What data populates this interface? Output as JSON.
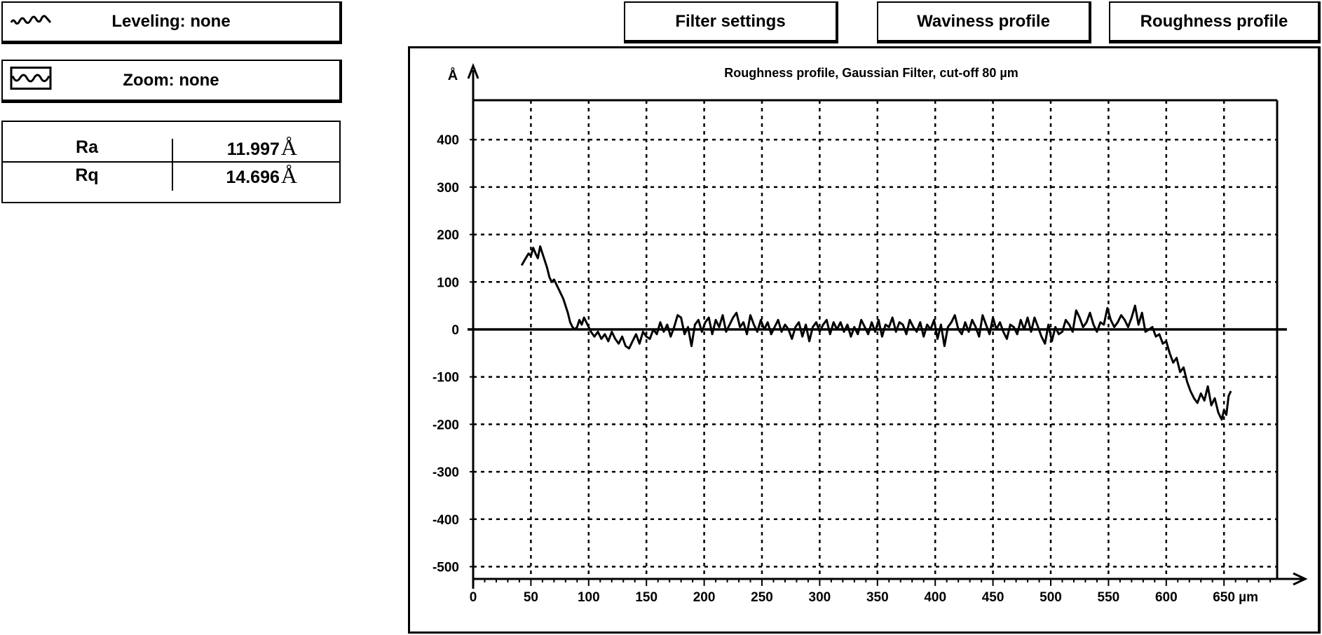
{
  "left_panel": {
    "leveling_button": {
      "label": "Leveling: none",
      "icon": "wave-icon"
    },
    "zoom_button": {
      "label": "Zoom: none",
      "icon": "boxed-wave-icon"
    },
    "metrics": [
      {
        "name": "Ra",
        "value": "11.997",
        "unit": "Å"
      },
      {
        "name": "Rq",
        "value": "14.696",
        "unit": "Å"
      }
    ]
  },
  "toolbar": {
    "filter_settings": "Filter settings",
    "waviness_profile": "Waviness profile",
    "roughness_profile": "Roughness profile"
  },
  "chart_data": {
    "type": "line",
    "title": "Roughness profile, Gaussian Filter, cut-off 80 µm",
    "xlabel": "µm",
    "ylabel": "Å",
    "xlim": [
      0,
      700
    ],
    "ylim": [
      -525,
      485
    ],
    "x_ticks": [
      0,
      50,
      100,
      150,
      200,
      250,
      300,
      350,
      400,
      450,
      500,
      550,
      600,
      650
    ],
    "x_tick_labels": [
      "0",
      "50",
      "100",
      "150",
      "200",
      "250",
      "300",
      "350",
      "400",
      "450",
      "500",
      "550",
      "600",
      "650 µm"
    ],
    "y_ticks": [
      400,
      300,
      200,
      100,
      0,
      -100,
      -200,
      -300,
      -400,
      -500
    ],
    "y_tick_labels": [
      "400",
      "300",
      "200",
      "100",
      "0",
      "-100",
      "-200",
      "-300",
      "-400",
      "-500"
    ],
    "grid": true,
    "legend": "none",
    "series": [
      {
        "name": "Roughness profile",
        "x": [
          42,
          45,
          48,
          50,
          52,
          54,
          56,
          58,
          60,
          62,
          64,
          66,
          68,
          70,
          72,
          74,
          76,
          78,
          80,
          82,
          84,
          86,
          88,
          90,
          92,
          94,
          96,
          98,
          100,
          102,
          105,
          108,
          111,
          114,
          117,
          120,
          123,
          126,
          129,
          132,
          135,
          138,
          141,
          144,
          147,
          150,
          153,
          156,
          159,
          162,
          165,
          168,
          171,
          174,
          177,
          180,
          183,
          186,
          189,
          192,
          195,
          198,
          201,
          204,
          207,
          210,
          213,
          216,
          219,
          222,
          225,
          228,
          231,
          234,
          237,
          240,
          243,
          246,
          249,
          252,
          255,
          258,
          261,
          264,
          267,
          270,
          273,
          276,
          279,
          282,
          285,
          288,
          291,
          294,
          297,
          300,
          303,
          306,
          309,
          312,
          315,
          318,
          321,
          324,
          327,
          330,
          333,
          336,
          339,
          342,
          345,
          348,
          351,
          354,
          357,
          360,
          363,
          366,
          369,
          372,
          375,
          378,
          381,
          384,
          387,
          390,
          393,
          396,
          399,
          402,
          405,
          408,
          411,
          414,
          417,
          420,
          423,
          426,
          429,
          432,
          435,
          438,
          441,
          444,
          447,
          450,
          453,
          456,
          459,
          462,
          465,
          468,
          471,
          474,
          477,
          480,
          483,
          486,
          489,
          492,
          495,
          498,
          501,
          504,
          507,
          510,
          513,
          516,
          519,
          522,
          525,
          528,
          531,
          534,
          537,
          540,
          543,
          546,
          549,
          552,
          555,
          558,
          561,
          564,
          567,
          570,
          573,
          576,
          579,
          582,
          585,
          588,
          591,
          594,
          597,
          600,
          603,
          606,
          609,
          612,
          615,
          618,
          621,
          624,
          627,
          630,
          633,
          636,
          639,
          642,
          645,
          648,
          650,
          652,
          654,
          656,
          658
        ],
        "y": [
          135,
          148,
          160,
          155,
          172,
          160,
          150,
          175,
          160,
          145,
          130,
          110,
          100,
          105,
          95,
          85,
          75,
          65,
          50,
          35,
          15,
          5,
          0,
          5,
          20,
          10,
          25,
          15,
          5,
          -5,
          -15,
          -5,
          -20,
          -10,
          -25,
          -5,
          -20,
          -30,
          -15,
          -35,
          -40,
          -25,
          -10,
          -30,
          -5,
          -15,
          -20,
          0,
          -10,
          15,
          -5,
          10,
          -15,
          5,
          30,
          25,
          -10,
          5,
          -35,
          10,
          20,
          -5,
          15,
          25,
          -10,
          20,
          5,
          30,
          -5,
          10,
          25,
          35,
          5,
          15,
          -10,
          30,
          10,
          -5,
          20,
          0,
          15,
          -10,
          5,
          20,
          -5,
          10,
          0,
          -20,
          5,
          15,
          -15,
          10,
          -25,
          5,
          15,
          -5,
          10,
          20,
          -10,
          15,
          0,
          15,
          -5,
          10,
          -15,
          5,
          -10,
          20,
          5,
          -10,
          15,
          -5,
          20,
          -15,
          10,
          5,
          25,
          -5,
          15,
          10,
          -10,
          20,
          5,
          -5,
          15,
          -15,
          10,
          0,
          20,
          -20,
          10,
          -35,
          5,
          15,
          30,
          0,
          -10,
          15,
          -5,
          20,
          5,
          -15,
          30,
          10,
          -10,
          25,
          0,
          15,
          -5,
          -20,
          10,
          5,
          -10,
          20,
          0,
          25,
          -5,
          25,
          5,
          -15,
          -30,
          10,
          -25,
          5,
          -10,
          -5,
          20,
          10,
          -5,
          40,
          25,
          5,
          15,
          35,
          10,
          -5,
          15,
          10,
          45,
          20,
          5,
          15,
          30,
          20,
          5,
          25,
          50,
          10,
          35,
          -5,
          0,
          5,
          -15,
          -10,
          -30,
          -25,
          -50,
          -70,
          -60,
          -90,
          -80,
          -110,
          -130,
          -145,
          -155,
          -135,
          -150,
          -120,
          -160,
          -145,
          -175,
          -190,
          -170,
          -180,
          -140,
          -130
        ]
      }
    ]
  }
}
